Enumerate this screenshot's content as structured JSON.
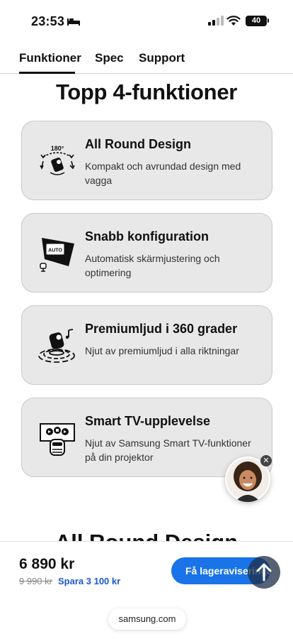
{
  "status_bar": {
    "time": "23:53",
    "battery": "40"
  },
  "tabs": [
    {
      "label": "Funktioner"
    },
    {
      "label": "Spec"
    },
    {
      "label": "Support"
    }
  ],
  "section_title": "Topp 4-funktioner",
  "features": [
    {
      "title": "All Round Design",
      "description": "Kompakt och avrundad design med vagga",
      "icon": "rotate-180-projector-icon",
      "icon_label": "180°"
    },
    {
      "title": "Snabb konfiguration",
      "description": "Automatisk skärmjustering och optimering",
      "icon": "auto-screen-icon",
      "icon_label": "AUTO"
    },
    {
      "title": "Premiumljud i 360 grader",
      "description": "Njut av premiumljud i alla riktningar",
      "icon": "360-sound-icon"
    },
    {
      "title": "Smart TV-upplevelse",
      "description": "Njut av Samsung Smart TV-funktioner på din projektor",
      "icon": "smart-tv-icon"
    }
  ],
  "next_heading": "All Round Design",
  "purchase": {
    "price": "6 890 kr",
    "old_price": "9 990 kr",
    "save_text": "Spara 3 100 kr",
    "button_label": "Få lageraviseringar"
  },
  "url": "samsung.com",
  "colors": {
    "accent": "#1a73e8",
    "card_bg": "#e8e8e8",
    "save_text": "#1a56d8"
  }
}
